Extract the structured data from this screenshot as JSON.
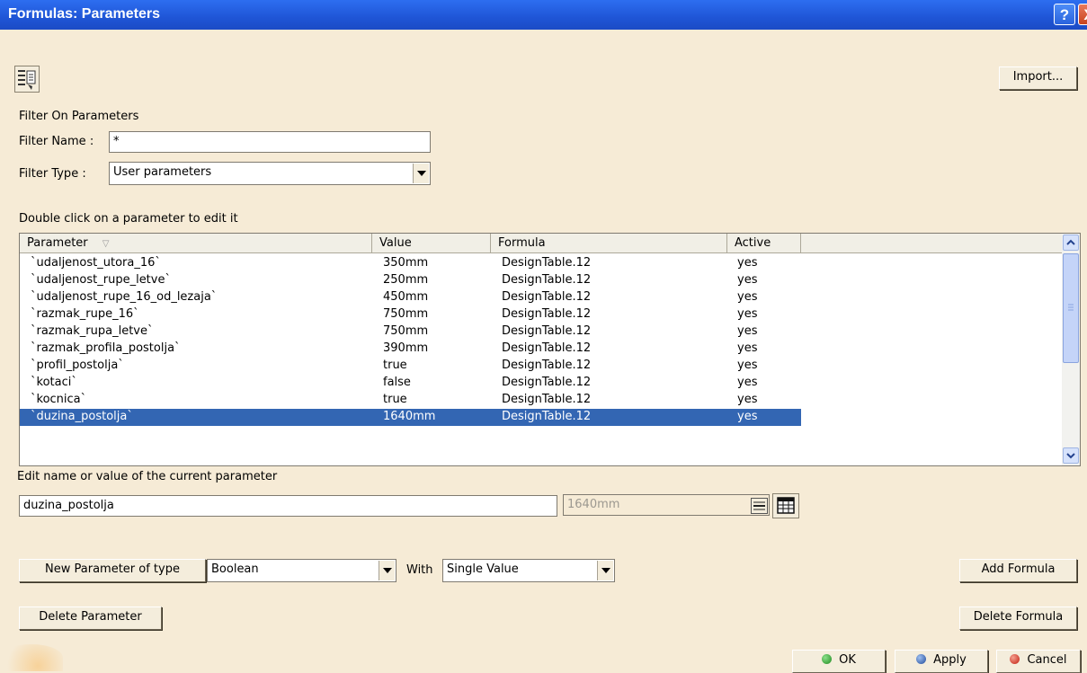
{
  "window": {
    "title": "Formulas: Parameters",
    "help": "?",
    "close": "X"
  },
  "toolbar": {
    "import_label": "Import..."
  },
  "filter": {
    "section_label": "Filter On Parameters",
    "name_label": "Filter Name :",
    "name_value": "*",
    "type_label": "Filter Type :",
    "type_value": "User parameters"
  },
  "table": {
    "hint": "Double click on a parameter to edit it",
    "columns": [
      "Parameter",
      "Value",
      "Formula",
      "Active"
    ],
    "rows": [
      [
        "`udaljenost_utora_16`",
        "350mm",
        "DesignTable.12",
        "yes"
      ],
      [
        "`udaljenost_rupe_letve`",
        "250mm",
        "DesignTable.12",
        "yes"
      ],
      [
        "`udaljenost_rupe_16_od_lezaja`",
        "450mm",
        "DesignTable.12",
        "yes"
      ],
      [
        "`razmak_rupe_16`",
        "750mm",
        "DesignTable.12",
        "yes"
      ],
      [
        "`razmak_rupa_letve`",
        "750mm",
        "DesignTable.12",
        "yes"
      ],
      [
        "`razmak_profila_postolja`",
        "390mm",
        "DesignTable.12",
        "yes"
      ],
      [
        "`profil_postolja`",
        "true",
        "DesignTable.12",
        "yes"
      ],
      [
        "`kotaci`",
        "false",
        "DesignTable.12",
        "yes"
      ],
      [
        "`kocnica`",
        "true",
        "DesignTable.12",
        "yes"
      ],
      [
        "`duzina_postolja`",
        "1640mm",
        "DesignTable.12",
        "yes"
      ]
    ],
    "selected_row": 9
  },
  "edit": {
    "label": "Edit name or value of the current parameter",
    "name_value": "duzina_postolja",
    "value_value": "1640mm"
  },
  "new_param": {
    "button_label": "New Parameter of type",
    "type_value": "Boolean",
    "with_label": "With",
    "with_value": "Single Value"
  },
  "buttons": {
    "add_formula": "Add Formula",
    "delete_parameter": "Delete Parameter",
    "delete_formula": "Delete Formula",
    "ok": "OK",
    "apply": "Apply",
    "cancel": "Cancel"
  },
  "colors": {
    "title_bar": "#1f55d6",
    "dialog_bg": "#f6ebd6",
    "selection": "#3366b3",
    "ok_dot": "#2a9d2a",
    "apply_dot": "#2e5da8",
    "cancel_dot": "#d22b1e"
  }
}
